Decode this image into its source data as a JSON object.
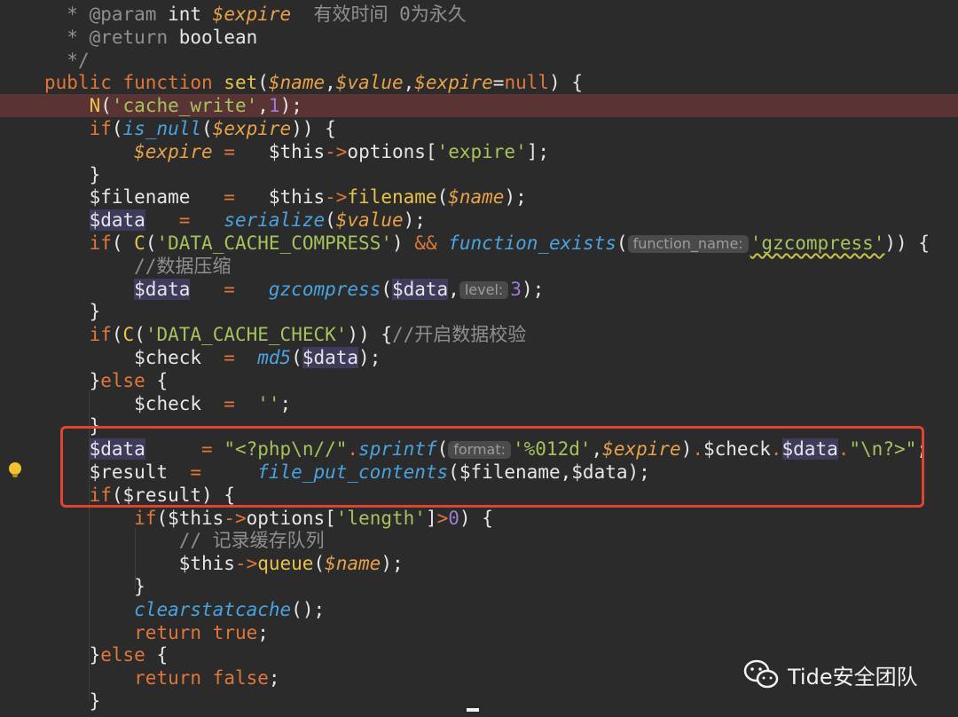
{
  "lines": [
    {
      "segments": [
        {
          "t": "  ",
          "c": ""
        },
        {
          "t": "* ",
          "c": "c"
        },
        {
          "t": "@param",
          "c": "c"
        },
        {
          "t": " int ",
          "c": ""
        },
        {
          "t": "$expire",
          "c": "v"
        },
        {
          "t": "  有效时间 0为永久",
          "c": "c"
        }
      ]
    },
    {
      "segments": [
        {
          "t": "  ",
          "c": ""
        },
        {
          "t": "* ",
          "c": "c"
        },
        {
          "t": "@return",
          "c": "c"
        },
        {
          "t": " boolean",
          "c": ""
        }
      ]
    },
    {
      "segments": [
        {
          "t": "  ",
          "c": ""
        },
        {
          "t": "*/",
          "c": "c"
        }
      ]
    },
    {
      "segments": [
        {
          "t": "public function ",
          "c": "kw"
        },
        {
          "t": "set",
          "c": "fn"
        },
        {
          "t": "(",
          "c": ""
        },
        {
          "t": "$name",
          "c": "v"
        },
        {
          "t": ",",
          "c": ""
        },
        {
          "t": "$value",
          "c": "v"
        },
        {
          "t": ",",
          "c": ""
        },
        {
          "t": "$expire",
          "c": "v"
        },
        {
          "t": "=",
          "c": ""
        },
        {
          "t": "null",
          "c": "kw"
        },
        {
          "t": ") {",
          "c": ""
        }
      ]
    },
    {
      "highlight": true,
      "segments": [
        {
          "t": "    ",
          "c": ""
        },
        {
          "t": "N",
          "c": "fn"
        },
        {
          "t": "(",
          "c": ""
        },
        {
          "t": "'cache_write'",
          "c": "s"
        },
        {
          "t": ",",
          "c": ""
        },
        {
          "t": "1",
          "c": "n"
        },
        {
          "t": ");",
          "c": ""
        }
      ]
    },
    {
      "segments": [
        {
          "t": "    ",
          "c": ""
        },
        {
          "t": "if",
          "c": "kw"
        },
        {
          "t": "(",
          "c": ""
        },
        {
          "t": "is_null",
          "c": "fi"
        },
        {
          "t": "(",
          "c": ""
        },
        {
          "t": "$expire",
          "c": "v"
        },
        {
          "t": ")) {",
          "c": ""
        }
      ]
    },
    {
      "segments": [
        {
          "t": "        ",
          "c": ""
        },
        {
          "t": "$expire",
          "c": "v"
        },
        {
          "t": " = ",
          "c": "op"
        },
        {
          "t": "  $this",
          "c": "pv"
        },
        {
          "t": "->",
          "c": "op"
        },
        {
          "t": "options[",
          "c": ""
        },
        {
          "t": "'expire'",
          "c": "s"
        },
        {
          "t": "];",
          "c": ""
        }
      ]
    },
    {
      "segments": [
        {
          "t": "    }",
          "c": ""
        }
      ]
    },
    {
      "segments": [
        {
          "t": "    ",
          "c": ""
        },
        {
          "t": "$filename",
          "c": "pv"
        },
        {
          "t": "   =   ",
          "c": "op"
        },
        {
          "t": "$this",
          "c": "pv"
        },
        {
          "t": "->",
          "c": "op"
        },
        {
          "t": "filename",
          "c": "fn"
        },
        {
          "t": "(",
          "c": ""
        },
        {
          "t": "$name",
          "c": "v"
        },
        {
          "t": ");",
          "c": ""
        }
      ]
    },
    {
      "segments": [
        {
          "t": "    ",
          "c": ""
        },
        {
          "t": "$data",
          "c": "pv hl"
        },
        {
          "t": "   =   ",
          "c": "op"
        },
        {
          "t": "serialize",
          "c": "fi"
        },
        {
          "t": "(",
          "c": ""
        },
        {
          "t": "$value",
          "c": "v"
        },
        {
          "t": ");",
          "c": ""
        }
      ]
    },
    {
      "segments": [
        {
          "t": "    ",
          "c": ""
        },
        {
          "t": "if",
          "c": "kw"
        },
        {
          "t": "( ",
          "c": ""
        },
        {
          "t": "C",
          "c": "fn"
        },
        {
          "t": "(",
          "c": ""
        },
        {
          "t": "'DATA_CACHE_COMPRESS'",
          "c": "s"
        },
        {
          "t": ") ",
          "c": ""
        },
        {
          "t": "&&",
          "c": "op"
        },
        {
          "t": " ",
          "c": ""
        },
        {
          "t": "function_exists",
          "c": "fi"
        },
        {
          "t": "(",
          "c": ""
        },
        {
          "hint": "function_name:"
        },
        {
          "t": "'gzcompress'",
          "c": "s squiggle"
        },
        {
          "t": ")) {",
          "c": ""
        }
      ]
    },
    {
      "segments": [
        {
          "t": "        ",
          "c": ""
        },
        {
          "t": "//数据压缩",
          "c": "c"
        }
      ]
    },
    {
      "segments": [
        {
          "t": "        ",
          "c": ""
        },
        {
          "t": "$data",
          "c": "pv hl"
        },
        {
          "t": "   =   ",
          "c": "op"
        },
        {
          "t": "gzcompress",
          "c": "fi"
        },
        {
          "t": "(",
          "c": ""
        },
        {
          "t": "$data",
          "c": "pv hl"
        },
        {
          "t": ",",
          "c": ""
        },
        {
          "hint": "level:"
        },
        {
          "t": "3",
          "c": "n"
        },
        {
          "t": ");",
          "c": ""
        }
      ]
    },
    {
      "segments": [
        {
          "t": "    }",
          "c": ""
        }
      ]
    },
    {
      "segments": [
        {
          "t": "    ",
          "c": ""
        },
        {
          "t": "if",
          "c": "kw"
        },
        {
          "t": "(",
          "c": ""
        },
        {
          "t": "C",
          "c": "fn"
        },
        {
          "t": "(",
          "c": ""
        },
        {
          "t": "'DATA_CACHE_CHECK'",
          "c": "s"
        },
        {
          "t": ")) {",
          "c": ""
        },
        {
          "t": "//开启数据校验",
          "c": "c"
        }
      ]
    },
    {
      "segments": [
        {
          "t": "        ",
          "c": ""
        },
        {
          "t": "$check",
          "c": "pv"
        },
        {
          "t": "  =  ",
          "c": "op"
        },
        {
          "t": "md5",
          "c": "fi"
        },
        {
          "t": "(",
          "c": ""
        },
        {
          "t": "$data",
          "c": "pv hl"
        },
        {
          "t": ");",
          "c": ""
        }
      ]
    },
    {
      "segments": [
        {
          "t": "    }",
          "c": ""
        },
        {
          "t": "else",
          "c": "kw"
        },
        {
          "t": " {",
          "c": ""
        }
      ]
    },
    {
      "segments": [
        {
          "t": "        ",
          "c": ""
        },
        {
          "t": "$check",
          "c": "pv"
        },
        {
          "t": "  =  ",
          "c": "op"
        },
        {
          "t": "''",
          "c": "s"
        },
        {
          "t": ";",
          "c": ""
        }
      ]
    },
    {
      "segments": [
        {
          "t": "    }",
          "c": ""
        }
      ]
    },
    {
      "segments": [
        {
          "t": "    ",
          "c": ""
        },
        {
          "t": "$data",
          "c": "pv hl"
        },
        {
          "t": "     = ",
          "c": "op"
        },
        {
          "t": "\"<?php\\n//\"",
          "c": "s"
        },
        {
          "t": ".",
          "c": "op"
        },
        {
          "t": "sprintf",
          "c": "fi"
        },
        {
          "t": "(",
          "c": ""
        },
        {
          "hint": "format:"
        },
        {
          "t": "'%012d'",
          "c": "s"
        },
        {
          "t": ",",
          "c": ""
        },
        {
          "t": "$expire",
          "c": "v"
        },
        {
          "t": ")",
          "c": ""
        },
        {
          "t": ".",
          "c": "op"
        },
        {
          "t": "$check",
          "c": "pv"
        },
        {
          "t": ".",
          "c": "op"
        },
        {
          "t": "$data",
          "c": "pv hl"
        },
        {
          "t": ".",
          "c": "op"
        },
        {
          "t": "\"\\n?>\"",
          "c": "s"
        },
        {
          "t": ";",
          "c": ""
        }
      ]
    },
    {
      "segments": [
        {
          "t": "    ",
          "c": ""
        },
        {
          "t": "$result",
          "c": "pv"
        },
        {
          "t": "  =   ",
          "c": "op"
        },
        {
          "t": "  file_put_contents",
          "c": "fi"
        },
        {
          "t": "(",
          "c": ""
        },
        {
          "t": "$filename",
          "c": "pv"
        },
        {
          "t": ",",
          "c": ""
        },
        {
          "t": "$data",
          "c": "pv"
        },
        {
          "t": ");",
          "c": ""
        }
      ]
    },
    {
      "segments": [
        {
          "t": "    ",
          "c": ""
        },
        {
          "t": "if",
          "c": "kw"
        },
        {
          "t": "(",
          "c": ""
        },
        {
          "t": "$result",
          "c": "pv"
        },
        {
          "t": ") {",
          "c": ""
        }
      ]
    },
    {
      "segments": [
        {
          "t": "        ",
          "c": ""
        },
        {
          "t": "if",
          "c": "kw"
        },
        {
          "t": "(",
          "c": ""
        },
        {
          "t": "$this",
          "c": "pv"
        },
        {
          "t": "->",
          "c": "op"
        },
        {
          "t": "options[",
          "c": ""
        },
        {
          "t": "'length'",
          "c": "s"
        },
        {
          "t": "]",
          "c": ""
        },
        {
          "t": ">",
          "c": "op"
        },
        {
          "t": "0",
          "c": "n"
        },
        {
          "t": ") {",
          "c": ""
        }
      ]
    },
    {
      "segments": [
        {
          "t": "            ",
          "c": ""
        },
        {
          "t": "// 记录缓存队列",
          "c": "c"
        }
      ]
    },
    {
      "segments": [
        {
          "t": "            ",
          "c": ""
        },
        {
          "t": "$this",
          "c": "pv"
        },
        {
          "t": "->",
          "c": "op"
        },
        {
          "t": "queue",
          "c": "fn"
        },
        {
          "t": "(",
          "c": ""
        },
        {
          "t": "$name",
          "c": "v"
        },
        {
          "t": ");",
          "c": ""
        }
      ]
    },
    {
      "segments": [
        {
          "t": "        }",
          "c": ""
        }
      ]
    },
    {
      "segments": [
        {
          "t": "        ",
          "c": ""
        },
        {
          "t": "clearstatcache",
          "c": "fi"
        },
        {
          "t": "();",
          "c": ""
        }
      ]
    },
    {
      "segments": [
        {
          "t": "        ",
          "c": ""
        },
        {
          "t": "return ",
          "c": "kw"
        },
        {
          "t": "true",
          "c": "bt"
        },
        {
          "t": ";",
          "c": ""
        }
      ]
    },
    {
      "segments": [
        {
          "t": "    }",
          "c": ""
        },
        {
          "t": "else",
          "c": "kw"
        },
        {
          "t": " {",
          "c": ""
        }
      ]
    },
    {
      "segments": [
        {
          "t": "        ",
          "c": ""
        },
        {
          "t": "return ",
          "c": "kw"
        },
        {
          "t": "false",
          "c": "bt"
        },
        {
          "t": ";",
          "c": ""
        }
      ]
    },
    {
      "segments": [
        {
          "t": "    }",
          "c": ""
        }
      ]
    }
  ],
  "watermark": {
    "text": "Tide安全团队",
    "icon": "wechat-icon"
  }
}
